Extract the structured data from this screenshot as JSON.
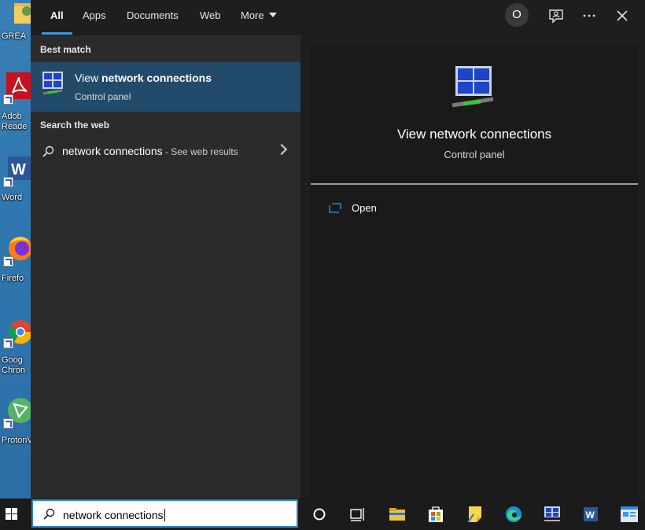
{
  "desktop": {
    "icons": [
      {
        "label": "GREA",
        "name": "folder"
      },
      {
        "label": "Adob\nReade",
        "name": "adobe-reader"
      },
      {
        "label": "Word",
        "name": "word"
      },
      {
        "label": "Firefo",
        "name": "firefox"
      },
      {
        "label": "Goog\nChron",
        "name": "chrome"
      },
      {
        "label": "ProtonV",
        "name": "protonvpn"
      }
    ]
  },
  "tabs": {
    "all": "All",
    "apps": "Apps",
    "documents": "Documents",
    "web": "Web",
    "more": "More"
  },
  "header": {
    "avatar_letter": "O"
  },
  "left": {
    "best_match_heading": "Best match",
    "best_match": {
      "title_prefix": "View ",
      "title_bold": "network connections",
      "subtitle": "Control panel"
    },
    "web_heading": "Search the web",
    "web_result": {
      "query": "network connections",
      "suffix": " - See web results"
    }
  },
  "right": {
    "title": "View network connections",
    "subtitle": "Control panel",
    "actions": [
      {
        "label": "Open"
      }
    ]
  },
  "taskbar": {
    "search_value": "network connections",
    "apps": [
      "cortana",
      "task-view",
      "file-explorer",
      "microsoft-store",
      "sticky-notes",
      "edge",
      "network-connections",
      "word",
      "control-panel"
    ]
  },
  "colors": {
    "accent": "#3b95db",
    "selected_bg": "#224a6b",
    "panel_bg": "#2b2b2b",
    "preview_bg": "#1a1a1a"
  }
}
